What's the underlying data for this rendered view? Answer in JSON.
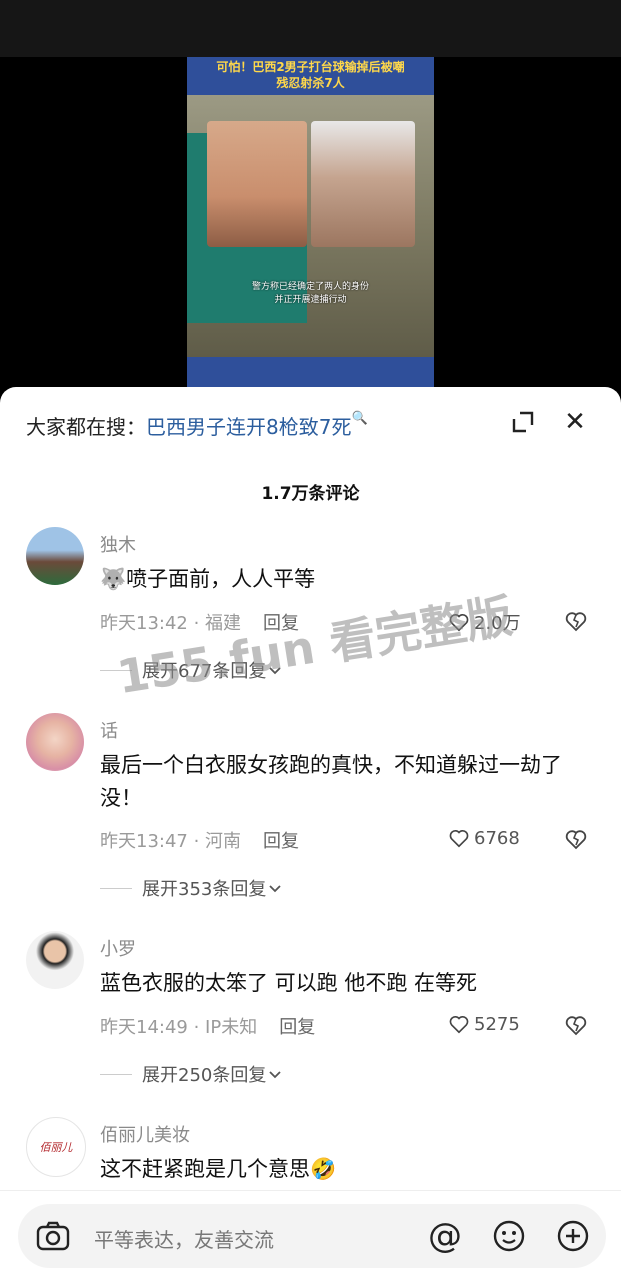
{
  "video": {
    "title_line1": "可怕！巴西2男子打台球输掉后被嘲",
    "title_line2": "残忍射杀7人",
    "subtitle_line1": "警方称已经确定了两人的身份",
    "subtitle_line2": "并正开展逮捕行动"
  },
  "search": {
    "prefix": "大家都在搜：",
    "query": "巴西男子连开8枪致7死",
    "mag": "🔍"
  },
  "close": "✕",
  "comment_count": "1.7万条评论",
  "comments": [
    {
      "username": "独木",
      "text": "喷子面前，人人平等",
      "time_loc": "昨天13:42 · 福建",
      "reply": "回复",
      "likes": "2.0万",
      "expand": "展开677条回复",
      "emoji": "🐺"
    },
    {
      "username": "话",
      "text": "最后一个白衣服女孩跑的真快，不知道躲过一劫了没！",
      "time_loc": "昨天13:47 · 河南",
      "reply": "回复",
      "likes": "6768",
      "expand": "展开353条回复"
    },
    {
      "username": "小罗",
      "text": "蓝色衣服的太笨了 可以跑  他不跑 在等死",
      "time_loc": "昨天14:49 · IP未知",
      "reply": "回复",
      "likes": "5275",
      "expand": "展开250条回复"
    },
    {
      "username": "佰丽儿美妆",
      "text": "这不赶紧跑是几个意思",
      "emoji": "🤣",
      "avatar_text": "佰丽儿"
    }
  ],
  "watermark": "155.fun 看完整版",
  "input": {
    "placeholder": "平等表达，友善交流",
    "at": "@"
  },
  "colors": {
    "accent_link": "#2c5e9e",
    "video_bg": "#2f4f9a",
    "title_yellow": "#ffd84a"
  }
}
